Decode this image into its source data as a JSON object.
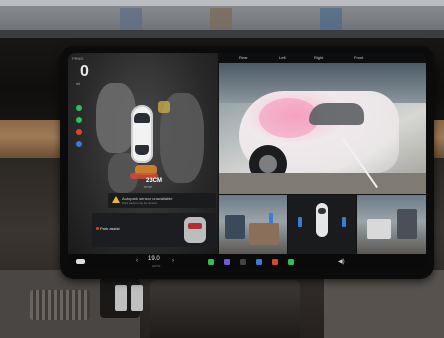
{
  "screen": {
    "status_left": "PRND",
    "gear": "0",
    "gear_sub": "mi",
    "distance": "23CM",
    "distance_sub": "STOP",
    "alert_title": "Autopark sensor unavailable",
    "alert_subtitle": "Park assist may be limited",
    "mini_label": "Park assist",
    "camera_header": [
      "Rear",
      "Left",
      "Right",
      "Front"
    ]
  },
  "dock": {
    "temperature": "19.0",
    "temperature_unit": "AUTO",
    "left_arrow": "‹",
    "right_arrow": "›",
    "volume_icon": "◀)"
  },
  "colors": {
    "alert_warning": "#e3b93b",
    "zone_near": "#d94b33",
    "zone_mid": "#e08a2c",
    "phone_app": "#2fbf58",
    "media_app": "#3a7bd5"
  }
}
